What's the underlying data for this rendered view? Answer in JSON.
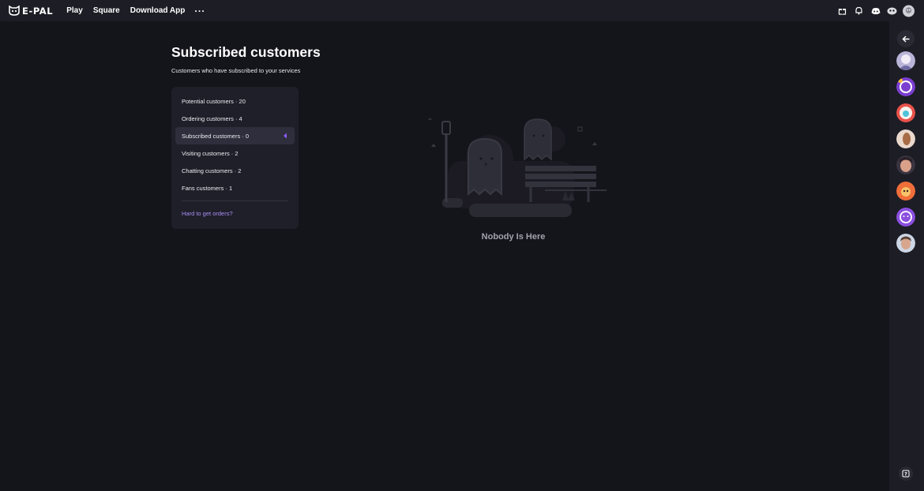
{
  "brand": {
    "name": "E-PAL"
  },
  "nav": {
    "items": [
      "Play",
      "Square",
      "Download App"
    ],
    "more": "···"
  },
  "topbar_icons": [
    "gift-icon",
    "bell-icon",
    "discord-icon",
    "game-controller-icon",
    "user-avatar"
  ],
  "page": {
    "title": "Subscribed customers",
    "subtitle": "Customers who have subscribed to your services"
  },
  "menu": {
    "items": [
      {
        "label": "Potential customers · 20",
        "active": false
      },
      {
        "label": "Ordering customers · 4",
        "active": false
      },
      {
        "label": "Subscribed customers · 0",
        "active": true
      },
      {
        "label": "Visiting customers · 2",
        "active": false
      },
      {
        "label": "Chatting customers · 2",
        "active": false
      },
      {
        "label": "Fans customers · 1",
        "active": false
      }
    ],
    "link": "Hard to get orders?"
  },
  "empty_state": {
    "text": "Nobody Is Here"
  },
  "sidebar": {
    "avatars": [
      "avatar-1",
      "avatar-2",
      "avatar-3",
      "avatar-4",
      "avatar-5",
      "avatar-6",
      "avatar-7",
      "avatar-8"
    ]
  },
  "colors": {
    "background": "#14141b",
    "panel": "#1f1f29",
    "accent": "#a98cf4",
    "active_caret": "#8b5cf6"
  }
}
